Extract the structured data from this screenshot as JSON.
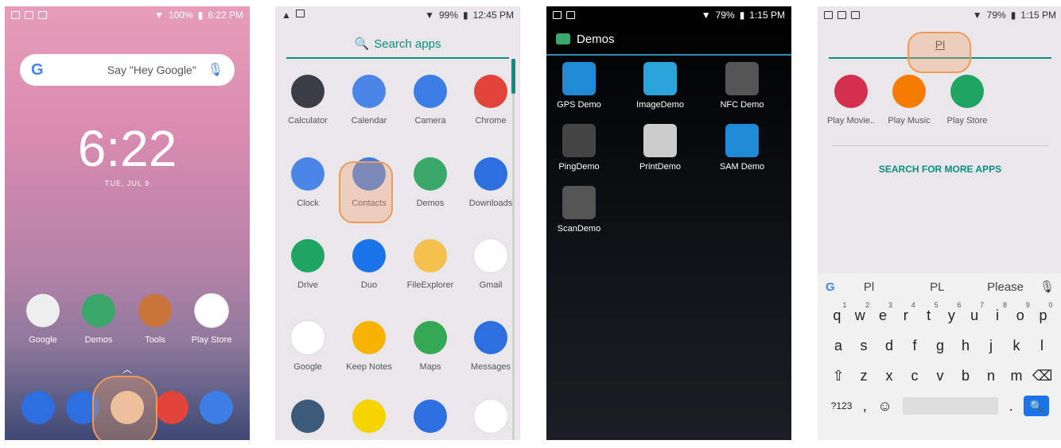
{
  "panel1": {
    "status_battery": "100%",
    "status_time": "6:22 PM",
    "search_hint": "Say \"Hey Google\"",
    "clock": "6:22",
    "date": "TUE, JUL 9",
    "apps": [
      {
        "label": "Google",
        "color": "#eeeeee"
      },
      {
        "label": "Demos",
        "color": "#3aa86b"
      },
      {
        "label": "Tools",
        "color": "#c8743a"
      },
      {
        "label": "Play Store",
        "color": "#ffffff"
      }
    ],
    "dock": [
      {
        "name": "phone",
        "color": "#2e6fe0"
      },
      {
        "name": "messages",
        "color": "#2e6fe0"
      },
      {
        "name": "apps",
        "color": "#e8d2b8"
      },
      {
        "name": "chrome",
        "color": "#e0443a"
      },
      {
        "name": "camera",
        "color": "#3d7ee6"
      }
    ]
  },
  "panel2": {
    "status_battery": "99%",
    "status_time": "12:45 PM",
    "search_label": "Search apps",
    "apps": [
      {
        "label": "Calculator",
        "color": "#3b3f45"
      },
      {
        "label": "Calendar",
        "color": "#4a86e8"
      },
      {
        "label": "Camera",
        "color": "#3d7ee6"
      },
      {
        "label": "Chrome",
        "color": "#e0443a"
      },
      {
        "label": "Clock",
        "color": "#4a86e8"
      },
      {
        "label": "Contacts",
        "color": "#3d7ee6"
      },
      {
        "label": "Demos",
        "color": "#3aa86b"
      },
      {
        "label": "Downloads",
        "color": "#2e6fe0"
      },
      {
        "label": "Drive",
        "color": "#1fa463"
      },
      {
        "label": "Duo",
        "color": "#1a73e8"
      },
      {
        "label": "FileExplorer",
        "color": "#f2c14e"
      },
      {
        "label": "Gmail",
        "color": "#ffffff"
      },
      {
        "label": "Google",
        "color": "#ffffff"
      },
      {
        "label": "Keep Notes",
        "color": "#f6b400"
      },
      {
        "label": "Maps",
        "color": "#34a853"
      },
      {
        "label": "Messages",
        "color": "#2e6fe0"
      },
      {
        "label": "",
        "color": "#3c5a7a"
      },
      {
        "label": "",
        "color": "#f6d400"
      },
      {
        "label": "",
        "color": "#2e6fe0"
      },
      {
        "label": "",
        "color": "#ffffff"
      }
    ]
  },
  "panel3": {
    "status_battery": "79%",
    "status_time": "1:15 PM",
    "title": "Demos",
    "apps": [
      {
        "label": "GPS Demo",
        "color": "#1f8ad6"
      },
      {
        "label": "ImageDemo",
        "color": "#29a3d9"
      },
      {
        "label": "NFC Demo",
        "color": "#555555"
      },
      {
        "label": "PingDemo",
        "color": "#444444"
      },
      {
        "label": "PrintDemo",
        "color": "#cccccc"
      },
      {
        "label": "SAM Demo",
        "color": "#1f8ad6"
      },
      {
        "label": "ScanDemo",
        "color": "#555555"
      }
    ]
  },
  "panel4": {
    "status_battery": "79%",
    "status_time": "1:15 PM",
    "typed": "Pl",
    "apps": [
      {
        "label": "Play Movie..",
        "color": "#d32f4f"
      },
      {
        "label": "Play Music",
        "color": "#f57c00"
      },
      {
        "label": "Play Store",
        "color": "#1fa463"
      }
    ],
    "more": "SEARCH FOR MORE APPS",
    "suggestions": [
      "Pl",
      "PL",
      "Please"
    ],
    "row1": [
      [
        "q",
        "1"
      ],
      [
        "w",
        "2"
      ],
      [
        "e",
        "3"
      ],
      [
        "r",
        "4"
      ],
      [
        "t",
        "5"
      ],
      [
        "y",
        "6"
      ],
      [
        "u",
        "7"
      ],
      [
        "i",
        "8"
      ],
      [
        "o",
        "9"
      ],
      [
        "p",
        "0"
      ]
    ],
    "row2": [
      "a",
      "s",
      "d",
      "f",
      "g",
      "h",
      "j",
      "k",
      "l"
    ],
    "row3": [
      "⇧",
      "z",
      "x",
      "c",
      "v",
      "b",
      "n",
      "m",
      "⌫"
    ],
    "row4": [
      "?123",
      ",",
      "☺",
      "",
      ".",
      "🔍"
    ]
  }
}
